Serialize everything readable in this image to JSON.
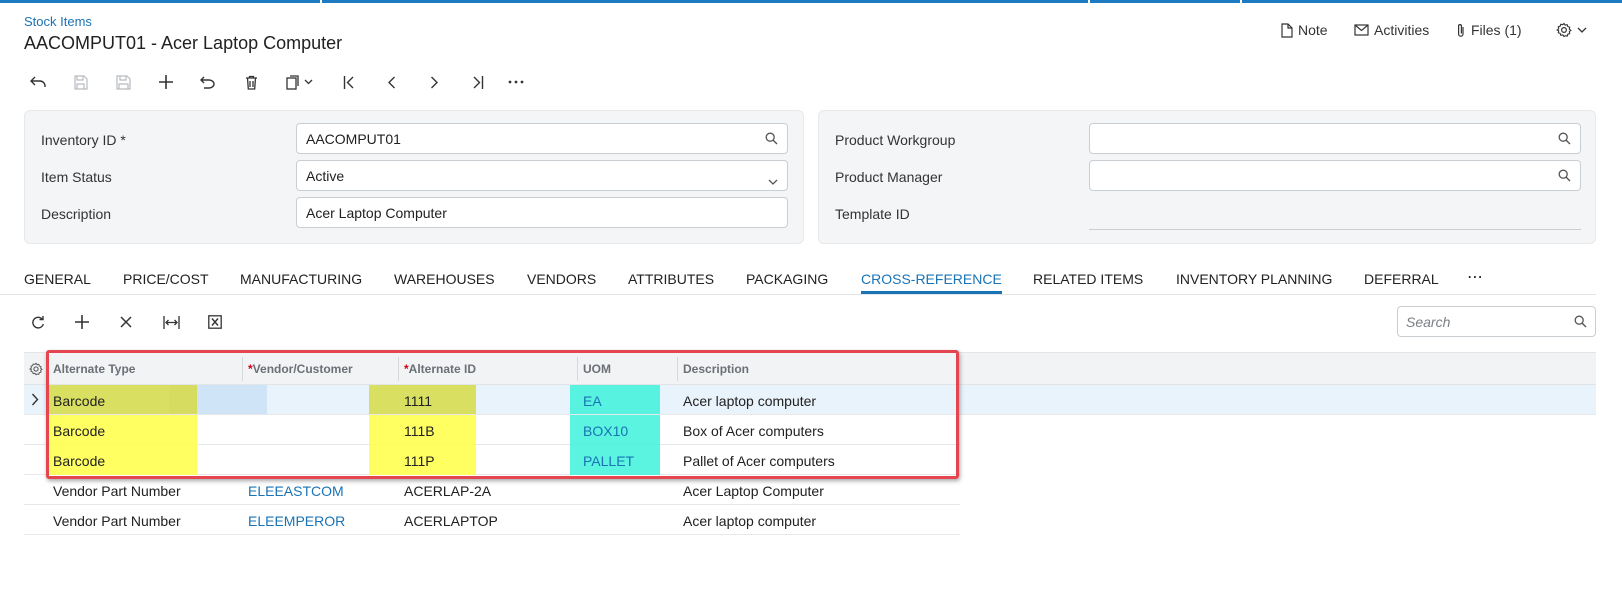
{
  "breadcrumb": "Stock Items",
  "title": "AACOMPUT01 - Acer Laptop Computer",
  "top_actions": {
    "note": "Note",
    "activities": "Activities",
    "files": "Files (1)"
  },
  "form": {
    "inventory_id": {
      "label": "Inventory ID",
      "required_mark": "*",
      "value": "AACOMPUT01"
    },
    "item_status": {
      "label": "Item Status",
      "value": "Active"
    },
    "description": {
      "label": "Description",
      "value": "Acer Laptop Computer"
    },
    "product_workgroup": {
      "label": "Product Workgroup",
      "value": ""
    },
    "product_manager": {
      "label": "Product Manager",
      "value": ""
    },
    "template_id": {
      "label": "Template ID",
      "value": ""
    }
  },
  "tabs": [
    {
      "label": "GENERAL"
    },
    {
      "label": "PRICE/COST"
    },
    {
      "label": "MANUFACTURING"
    },
    {
      "label": "WAREHOUSES"
    },
    {
      "label": "VENDORS"
    },
    {
      "label": "ATTRIBUTES"
    },
    {
      "label": "PACKAGING"
    },
    {
      "label": "CROSS-REFERENCE"
    },
    {
      "label": "RELATED ITEMS"
    },
    {
      "label": "INVENTORY PLANNING"
    },
    {
      "label": "DEFERRAL"
    },
    {
      "label": "⋯"
    }
  ],
  "active_tab": "CROSS-REFERENCE",
  "grid": {
    "search_placeholder": "Search",
    "columns": [
      {
        "label": "Alternate Type",
        "required_mark": ""
      },
      {
        "label": "Vendor/Customer",
        "required_mark": "*"
      },
      {
        "label": "Alternate ID",
        "required_mark": "*"
      },
      {
        "label": "UOM",
        "required_mark": ""
      },
      {
        "label": "Description",
        "required_mark": ""
      }
    ],
    "rows": [
      {
        "type": "Barcode",
        "vendor": "",
        "alt_id": "1111",
        "uom": "EA",
        "description": "Acer laptop computer"
      },
      {
        "type": "Barcode",
        "vendor": "",
        "alt_id": "111B",
        "uom": "BOX10",
        "description": "Box of Acer computers"
      },
      {
        "type": "Barcode",
        "vendor": "",
        "alt_id": "111P",
        "uom": "PALLET",
        "description": "Pallet of Acer computers"
      },
      {
        "type": "Vendor Part Number",
        "vendor": "ELEEASTCOM",
        "alt_id": "ACERLAP-2A",
        "uom": "",
        "description": "Acer Laptop Computer"
      },
      {
        "type": "Vendor Part Number",
        "vendor": "ELEEMPEROR",
        "alt_id": "ACERLAPTOP",
        "uom": "",
        "description": "Acer laptop computer"
      }
    ]
  },
  "colors": {
    "accent": "#1a73b4",
    "highlight_yellow": "#ffff47",
    "highlight_cyan": "#3ef2da",
    "annotation_frame": "#e5454f"
  }
}
